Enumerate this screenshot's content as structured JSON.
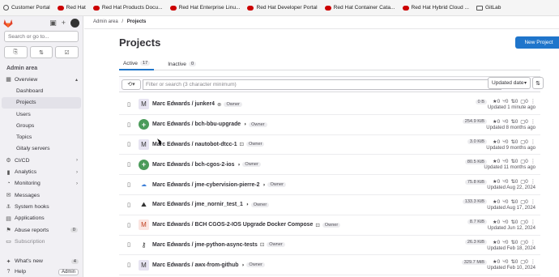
{
  "bookmarks": [
    {
      "label": "Customer Portal",
      "icon": "globe-icon"
    },
    {
      "label": "Red Hat",
      "icon": "redhat-icon"
    },
    {
      "label": "Red Hat Products Docu...",
      "icon": "redhat-icon"
    },
    {
      "label": "Red Hat Enterprise Linu...",
      "icon": "redhat-icon"
    },
    {
      "label": "Red Hat Developer Portal",
      "icon": "redhat-icon"
    },
    {
      "label": "Red Hat Container Cata...",
      "icon": "redhat-icon"
    },
    {
      "label": "Red Hat Hybrid Cloud ...",
      "icon": "redhat-icon"
    },
    {
      "label": "GitLab",
      "icon": "folder-icon"
    }
  ],
  "sidebar": {
    "search_placeholder": "Search or go to...",
    "section_title": "Admin area",
    "nav": [
      {
        "label": "Overview",
        "icon": "overview-icon",
        "expanded": true
      },
      {
        "label": "Dashboard",
        "sub": true
      },
      {
        "label": "Projects",
        "sub": true,
        "selected": true
      },
      {
        "label": "Users",
        "sub": true
      },
      {
        "label": "Groups",
        "sub": true
      },
      {
        "label": "Topics",
        "sub": true
      },
      {
        "label": "Gitaly servers",
        "sub": true
      },
      {
        "label": "CI/CD",
        "icon": "rocket-icon",
        "chevron": true
      },
      {
        "label": "Analytics",
        "icon": "chart-icon",
        "chevron": true
      },
      {
        "label": "Monitoring",
        "icon": "monitor-icon",
        "chevron": true
      },
      {
        "label": "Messages",
        "icon": "message-icon"
      },
      {
        "label": "System hooks",
        "icon": "hook-icon"
      },
      {
        "label": "Applications",
        "icon": "apps-icon"
      },
      {
        "label": "Abuse reports",
        "icon": "flag-icon",
        "count": "0"
      },
      {
        "label": "Subscription",
        "icon": "card-icon",
        "muted": true
      }
    ],
    "whats_new": "What's new",
    "whats_new_count": "4",
    "help": "Help",
    "admin": "Admin"
  },
  "breadcrumb": {
    "root": "Admin area",
    "sep": "/",
    "current": "Projects"
  },
  "page": {
    "title": "Projects",
    "new_project": "New Project",
    "tabs": [
      {
        "label": "Active",
        "count": "17",
        "active": true
      },
      {
        "label": "Inactive",
        "count": "0",
        "active": false
      }
    ],
    "filter_placeholder": "Filter or search (3 character minimum)",
    "sort_label": "Updated date"
  },
  "projects": [
    {
      "name": "Marc Edwards / junker4",
      "avatar": "M",
      "avatar_style": "letter",
      "visibility": "public",
      "role": "Owner",
      "size": "0 B",
      "stars": "0",
      "forks": "0",
      "mrs": "0",
      "issues": "0",
      "updated": "Updated 1 minute ago"
    },
    {
      "name": "Marc Edwards / bch-bbu-upgrade",
      "avatar": "+",
      "avatar_style": "gitlab",
      "visibility": "internal",
      "role": "Owner",
      "size": "254.9 KiB",
      "stars": "0",
      "forks": "0",
      "mrs": "0",
      "issues": "0",
      "updated": "Updated 8 months ago"
    },
    {
      "name": "Marc Edwards / nautobot-dtcc-1",
      "avatar": "M",
      "avatar_style": "letter",
      "visibility": "private",
      "role": "Owner",
      "size": "3.0 KiB",
      "stars": "0",
      "forks": "0",
      "mrs": "0",
      "issues": "0",
      "updated": "Updated 9 months ago"
    },
    {
      "name": "Marc Edwards / bch-cgos-2-ios",
      "avatar": "+",
      "avatar_style": "gitlab",
      "visibility": "internal",
      "role": "Owner",
      "size": "80.5 KiB",
      "stars": "0",
      "forks": "0",
      "mrs": "0",
      "issues": "0",
      "updated": "Updated 11 months ago"
    },
    {
      "name": "Marc Edwards / jme-cybervision-pierre-2",
      "avatar": "☁",
      "avatar_style": "cloud",
      "visibility": "internal",
      "role": "Owner",
      "size": "75.8 KiB",
      "stars": "0",
      "forks": "0",
      "mrs": "0",
      "issues": "0",
      "updated": "Updated Aug 22, 2024"
    },
    {
      "name": "Marc Edwards / jme_nornir_test_1",
      "avatar": "⛰",
      "avatar_style": "tree",
      "visibility": "internal",
      "role": "Owner",
      "size": "133.3 KiB",
      "stars": "0",
      "forks": "0",
      "mrs": "0",
      "issues": "0",
      "updated": "Updated Aug 17, 2024"
    },
    {
      "name": "Marc Edwards / BCH CGOS-2-IOS Upgrade Docker Compose",
      "avatar": "M",
      "avatar_style": "orange",
      "visibility": "private",
      "role": "Owner",
      "size": "8.7 KiB",
      "stars": "0",
      "forks": "0",
      "mrs": "0",
      "issues": "0",
      "updated": "Updated Jun 12, 2024"
    },
    {
      "name": "Marc Edwards / jme-python-async-tests",
      "avatar": "⚷",
      "avatar_style": "key",
      "visibility": "private",
      "role": "Owner",
      "size": "26.3 KiB",
      "stars": "0",
      "forks": "0",
      "mrs": "0",
      "issues": "0",
      "updated": "Updated Feb 18, 2024"
    },
    {
      "name": "Marc Edwards / awx-from-github",
      "avatar": "M",
      "avatar_style": "letter",
      "visibility": "internal",
      "role": "Owner",
      "size": "329.7 MiB",
      "stars": "0",
      "forks": "0",
      "mrs": "0",
      "issues": "0",
      "updated": "Updated Feb 10, 2024"
    }
  ],
  "colors": {
    "primary": "#1f75cb",
    "sidebar_bg": "#f1f0f4",
    "selected_bg": "#e3e2e9",
    "gitlab_orange": "#e24329"
  }
}
